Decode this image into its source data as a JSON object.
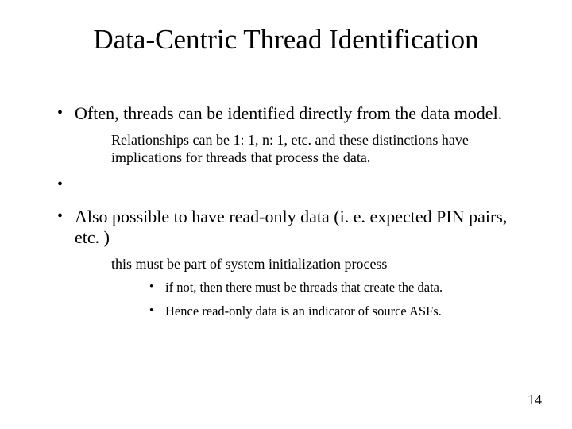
{
  "title": "Data-Centric Thread Identification",
  "bullets": [
    {
      "text": "Often, threads can be identified directly from the data model.",
      "sub": [
        {
          "text": "Relationships can be 1: 1, n: 1, etc. and these distinctions have implications for threads that process the data."
        }
      ]
    },
    {
      "text": "Also possible to have read-only data (i. e. expected PIN pairs, etc. )",
      "sub": [
        {
          "text": "this must be part of system initialization process",
          "sub": [
            {
              "text": "if not, then there must be threads that create the data."
            },
            {
              "text": "Hence read-only data is an indicator of source ASFs."
            }
          ]
        }
      ]
    }
  ],
  "page_number": "14"
}
